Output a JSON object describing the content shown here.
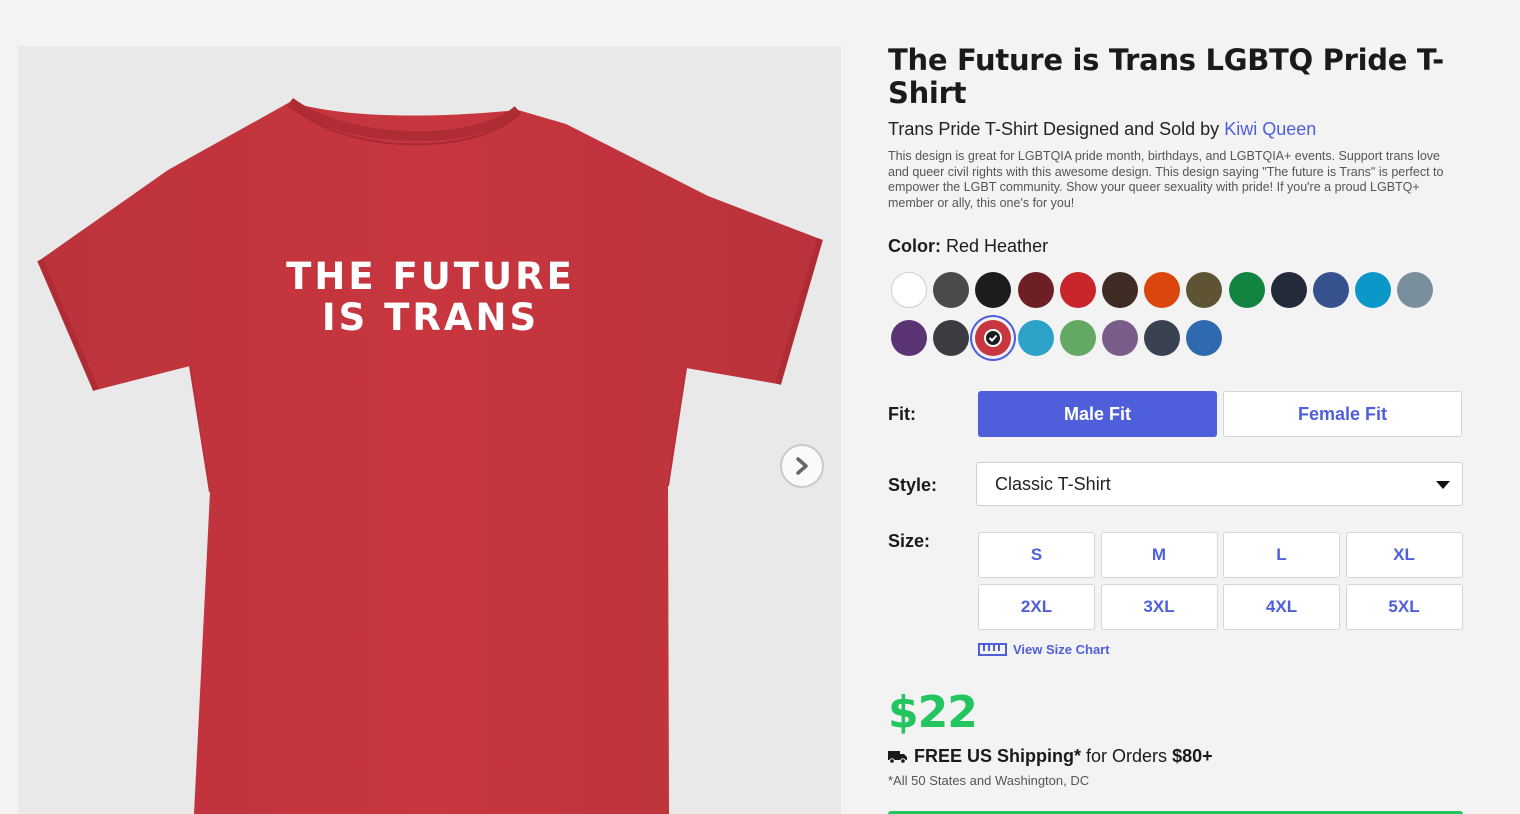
{
  "product": {
    "title": "The Future is Trans LGBTQ Pride T-Shirt",
    "subtitle_prefix": "Trans Pride T-Shirt Designed and Sold by",
    "designer": "Kiwi Queen",
    "description": "This design is great for LGBTQIA pride month, birthdays, and LGBTQIA+ events. Support trans love and queer civil rights with this awesome design. This design saying \"The future is Trans\" is perfect to empower the LGBT community. Show your queer sexuality with pride! If you're a proud LGBTQ+ member or ally, this one's for you!",
    "print_line1": "THE FUTURE",
    "print_line2": "IS TRANS",
    "shirt_color": "#c8363f"
  },
  "color": {
    "label": "Color:",
    "selected": "Red Heather",
    "swatches": [
      "#ffffff",
      "#4a4a4a",
      "#1c1c1c",
      "#6e1f26",
      "#c9262b",
      "#3f2c24",
      "#d9470f",
      "#5e5434",
      "#128442",
      "#252a3a",
      "#35528f",
      "#0b98c9",
      "#7a8f9c",
      "#5b3473",
      "#3b3c41",
      "#c8363f",
      "#2ca2c8",
      "#63a863",
      "#7a5c89",
      "#3a4252",
      "#2f6ab0"
    ]
  },
  "fit": {
    "label": "Fit:",
    "male": "Male Fit",
    "female": "Female Fit"
  },
  "style": {
    "label": "Style:",
    "value": "Classic T-Shirt"
  },
  "size": {
    "label": "Size:",
    "options": [
      "S",
      "M",
      "L",
      "XL",
      "2XL",
      "3XL",
      "4XL",
      "5XL"
    ],
    "chart_link": "View Size Chart"
  },
  "price": "$22",
  "shipping": {
    "bold": "FREE US Shipping*",
    "middle": "for Orders",
    "amount": "$80+",
    "note": "*All 50 States and Washington, DC"
  },
  "icons": {
    "next": "chevron-right-icon",
    "truck": "truck-icon",
    "ruler": "ruler-icon",
    "check": "checkmark-icon"
  }
}
